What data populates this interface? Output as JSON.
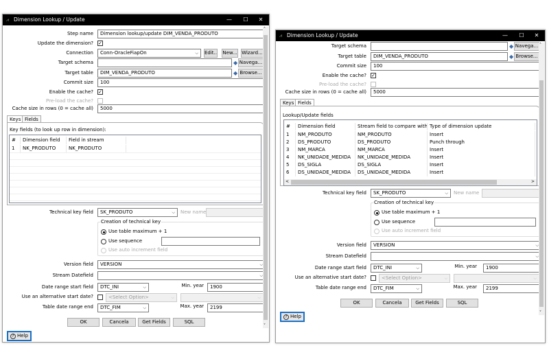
{
  "colors": {
    "titlebar": "#000000",
    "help_border": "#1a6fc4"
  },
  "window": {
    "title": "Dimension Lookup / Update",
    "minimize": "—",
    "maximize": "☐",
    "close": "✕",
    "icon": "chart-icon"
  },
  "form": {
    "step_name_label": "Step name",
    "step_name": "Dimension lookup/update DIM_VENDA_PRODUTO",
    "update_label": "Update the dimension?",
    "update_checked": true,
    "connection_label": "Connection",
    "connection": "Conn-OracleFiapOn",
    "edit": "Edit...",
    "new": "New...",
    "wizard": "Wizard...",
    "schema_label": "Target schema",
    "schema": "",
    "navega": "Navega...",
    "table_label": "Target table",
    "table": "DIM_VENDA_PRODUTO",
    "browse": "Browse...",
    "commit_label": "Commit size",
    "commit": "100",
    "cache_label": "Enable the cache?",
    "cache_checked": true,
    "preload_label": "Pre-load the cache?",
    "preload_checked": false,
    "cache_size_label": "Cache size in rows (0 = cache all)",
    "cache_size": "5000",
    "tabs": [
      "Keys",
      "Fields"
    ],
    "tech_key_label": "Technical key field",
    "tech_key": "SK_PRODUTO",
    "new_name_label": "New name",
    "new_name": "",
    "group_title": "Creation of technical key",
    "radio_max": "Use table maximum + 1",
    "radio_seq": "Use sequence",
    "radio_auto": "Use auto increment field",
    "sequence": "",
    "version_label": "Version field",
    "version": "VERSION",
    "stream_date_label": "Stream Datefield",
    "stream_date": "",
    "start_label": "Date range start field",
    "start": "DTC_INI",
    "min_year_label": "Min. year",
    "min_year": "1900",
    "alt_label": "Use an alternative start date?",
    "alt_option": "<Select Option>",
    "alt_value": "",
    "end_label": "Table date range end",
    "end": "DTC_FIM",
    "max_year_label": "Max. year",
    "max_year": "2199",
    "ok": "OK",
    "cancel": "Cancela",
    "get_fields": "Get Fields",
    "sql": "SQL",
    "help": "Help"
  },
  "left": {
    "active_tab": "Keys",
    "keys_label": "Key fields (to look up row in dimension):",
    "columns": [
      "#",
      "Dimension field",
      "Field in stream"
    ],
    "rows": [
      [
        "1",
        "NK_PRODUTO",
        "NK_PRODUTO"
      ]
    ]
  },
  "right": {
    "active_tab": "Fields",
    "fields_label": "Lookup/Update fields",
    "columns": [
      "#",
      "Dimension field",
      "Stream field to compare with",
      "Type of dimension update"
    ],
    "rows": [
      [
        "1",
        "NM_PRODUTO",
        "NM_PRODUTO",
        "Insert"
      ],
      [
        "2",
        "DS_PRODUTO",
        "DS_PRODUTO",
        "Punch through"
      ],
      [
        "3",
        "NM_MARCA",
        "NM_MARCA",
        "Insert"
      ],
      [
        "4",
        "NK_UNIDADE_MEDIDA",
        "NK_UNIDADE_MEDIDA",
        "Insert"
      ],
      [
        "5",
        "DS_SIGLA",
        "DS_SIGLA",
        "Insert"
      ],
      [
        "6",
        "DS_UNIDADE_MEDIDA",
        "DS_UNIDADE_MEDIDA",
        "Insert"
      ]
    ]
  }
}
